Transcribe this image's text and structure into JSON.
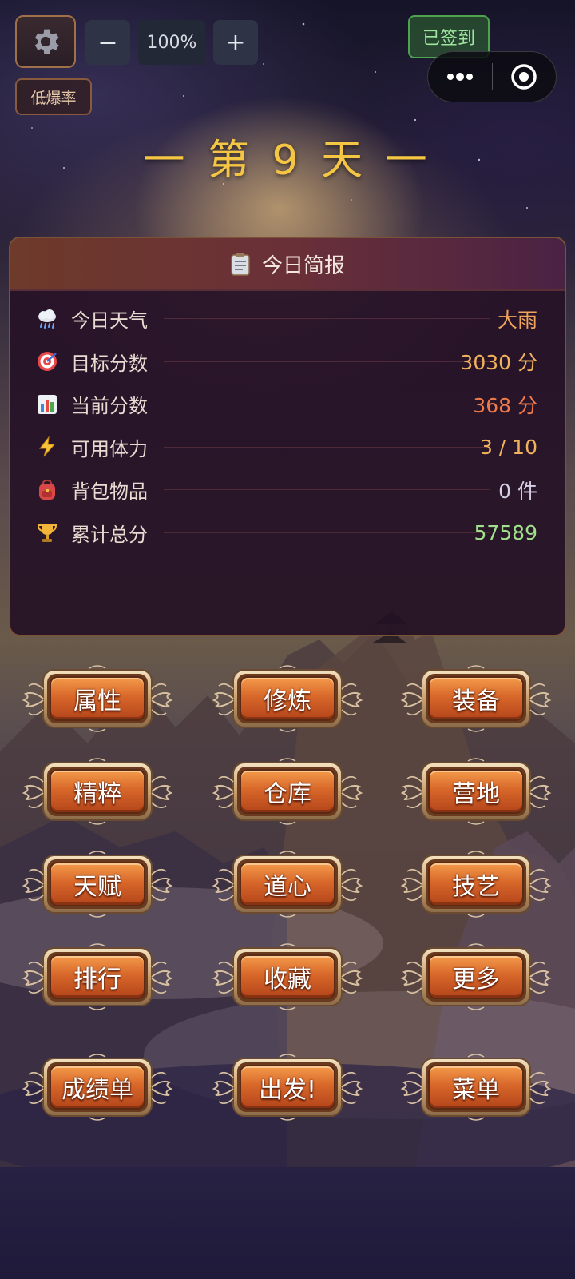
{
  "toolbar": {
    "settings_icon": "gear-icon",
    "zoom_out_label": "−",
    "zoom_value": "100%",
    "zoom_in_label": "+",
    "drop_rate_label": "低爆率",
    "signed_label": "已签到",
    "capsule": {
      "more_icon": "more-dots-icon",
      "close_icon": "target-circle-icon"
    }
  },
  "day_title": "一 第 9 天 一",
  "report": {
    "title": "今日简报",
    "title_icon": "clipboard-icon",
    "rows": [
      {
        "icon": "rain-cloud-icon",
        "label": "今日天气",
        "value": "大雨",
        "color": "#f0a35a"
      },
      {
        "icon": "target-icon",
        "label": "目标分数",
        "value": "3030 分",
        "color": "#f0b25a"
      },
      {
        "icon": "bar-chart-icon",
        "label": "当前分数",
        "value": "368 分",
        "color": "#ef7a4a"
      },
      {
        "icon": "lightning-icon",
        "label": "可用体力",
        "value": "3 / 10",
        "color": "#f0b25a"
      },
      {
        "icon": "backpack-icon",
        "label": "背包物品",
        "value": "0 件",
        "color": "#d6d0e6"
      },
      {
        "icon": "trophy-icon",
        "label": "累计总分",
        "value": "57589",
        "color": "#9fe08a"
      }
    ]
  },
  "menu_buttons": [
    "属性",
    "修炼",
    "装备",
    "精粹",
    "仓库",
    "营地",
    "天赋",
    "道心",
    "技艺",
    "排行",
    "收藏",
    "更多",
    "成绩单",
    "出发!",
    "菜单"
  ]
}
